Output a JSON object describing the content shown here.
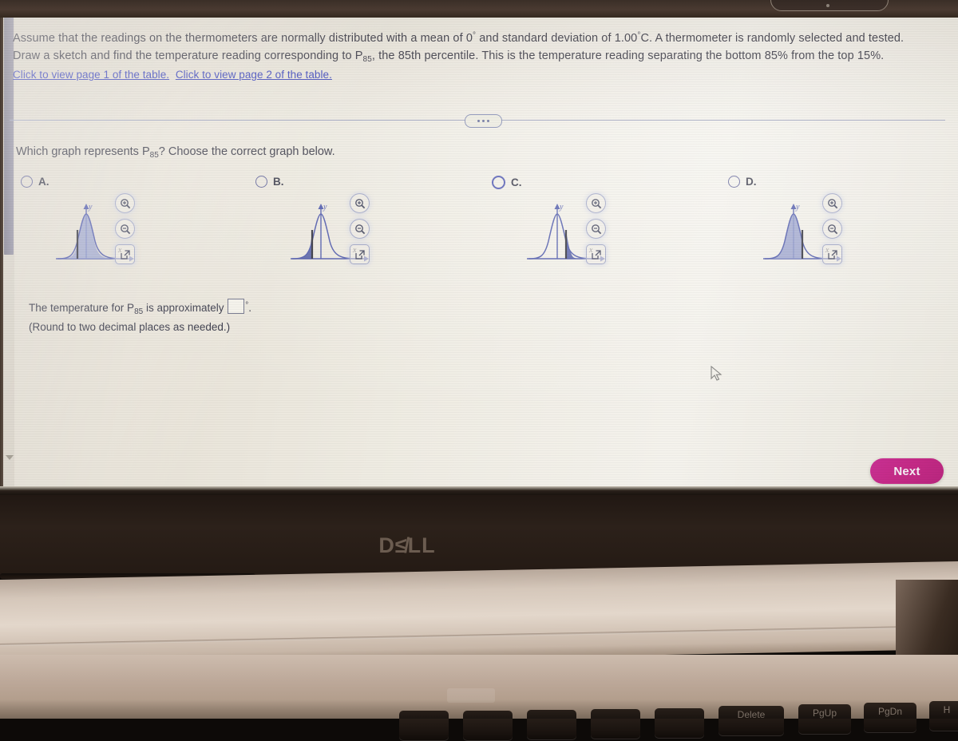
{
  "problem": {
    "sentence_1_pre": "Assume that the readings on the thermometers are normally distributed with a mean of 0",
    "sentence_1_deg": "°",
    "sentence_1_mid": " and standard deviation of 1.00",
    "sentence_1_deg2": "°",
    "sentence_1_post": "C. A thermometer is randomly selected and tested. Draw a sketch and find the temperature reading corresponding to P",
    "sub_85": "85",
    "sentence_1_tail": ", the 85th percentile. This is the temperature reading separating the bottom 85% from the top 15%.",
    "links": [
      {
        "label": "Click to view page 1 of the table.",
        "name": "table-page-1-link"
      },
      {
        "label": "Click to view page 2 of the table.",
        "name": "table-page-2-link"
      }
    ]
  },
  "prompt": {
    "pre": "Which graph represents P",
    "sub": "85",
    "post": "? Choose the correct graph below."
  },
  "options": [
    {
      "letter": "A.",
      "selected": false,
      "shaded": "right-of-line",
      "line_side": "left-of-peak"
    },
    {
      "letter": "B.",
      "selected": false,
      "shaded": "left-tail",
      "line_side": "left-of-peak"
    },
    {
      "letter": "C.",
      "selected": false,
      "shaded": "right-tail",
      "line_side": "right-of-peak"
    },
    {
      "letter": "D.",
      "selected": false,
      "shaded": "left-of-line",
      "line_side": "right-of-peak"
    }
  ],
  "graph_axis": {
    "y_label": "y",
    "x_label": "x"
  },
  "tools": [
    {
      "name": "zoom-in-icon",
      "title": "Zoom in"
    },
    {
      "name": "zoom-out-icon",
      "title": "Zoom out"
    },
    {
      "name": "open-popout-icon",
      "title": "Open in new window"
    }
  ],
  "answer": {
    "pre": "The temperature for P",
    "sub": "85",
    "mid": " is approximately ",
    "value": "",
    "degree": "°",
    "period": ".",
    "hint": "(Round to two decimal places as needed.)"
  },
  "footer": {
    "next_label": "Next"
  },
  "hardware": {
    "brand": "D≰LL",
    "keys": [
      "Delete",
      "PgUp",
      "PgDn",
      "H"
    ]
  },
  "colors": {
    "link": "#2a36b8",
    "radio": "#575a92",
    "next_button": "#c42a86",
    "curve": "#4a55a8",
    "shade": "#8d97c8",
    "text": "#2c2c3a"
  }
}
